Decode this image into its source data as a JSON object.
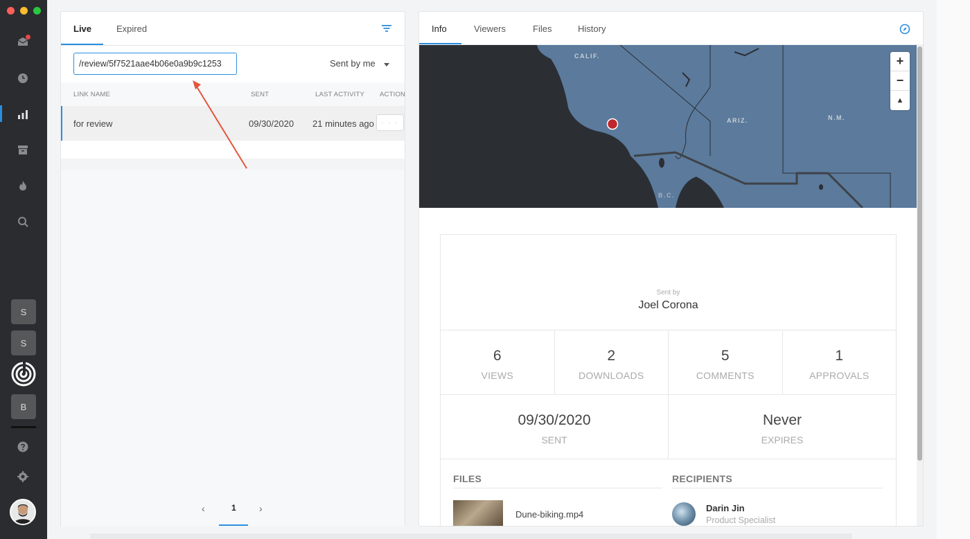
{
  "left_tabs": {
    "live": "Live",
    "expired": "Expired"
  },
  "search": {
    "value": "/review/5f7521aae4b06e0a9b9c1253"
  },
  "filter_sent": "Sent by me",
  "columns": {
    "link_name": "LINK NAME",
    "sent": "SENT",
    "last_activity": "LAST ACTIVITY",
    "action": "ACTION"
  },
  "rows": [
    {
      "name": "for review",
      "sent": "09/30/2020",
      "activity": "21 minutes ago",
      "action": "· · ·"
    }
  ],
  "pager": {
    "prev": "‹",
    "page": "1",
    "next": "›"
  },
  "workspaces": [
    "S",
    "S",
    "B"
  ],
  "right_tabs": {
    "info": "Info",
    "viewers": "Viewers",
    "files": "Files",
    "history": "History"
  },
  "map": {
    "labels": [
      "CALIF.",
      "ARIZ.",
      "N.M.",
      "B.C."
    ],
    "zoom_in": "+",
    "zoom_out": "−",
    "reset": "▲"
  },
  "info": {
    "sent_by_label": "Sent by",
    "sent_by_name": "Joel Corona",
    "stats": [
      {
        "value": "6",
        "label": "VIEWS"
      },
      {
        "value": "2",
        "label": "DOWNLOADS"
      },
      {
        "value": "5",
        "label": "COMMENTS"
      },
      {
        "value": "1",
        "label": "APPROVALS"
      }
    ],
    "sent_date": "09/30/2020",
    "sent_label": "SENT",
    "expires_value": "Never",
    "expires_label": "EXPIRES",
    "files_heading": "FILES",
    "recipients_heading": "RECIPIENTS",
    "file_name": "Dune-biking.mp4",
    "recipient_name": "Darin Jin",
    "recipient_role": "Product Specialist"
  },
  "colors": {
    "accent": "#2a8ee0",
    "sidebar": "#2b2c2f",
    "map_land": "#5b7a9c",
    "map_water": "#2b2e33",
    "pin": "#c0272d",
    "arrow": "#e4553a"
  }
}
